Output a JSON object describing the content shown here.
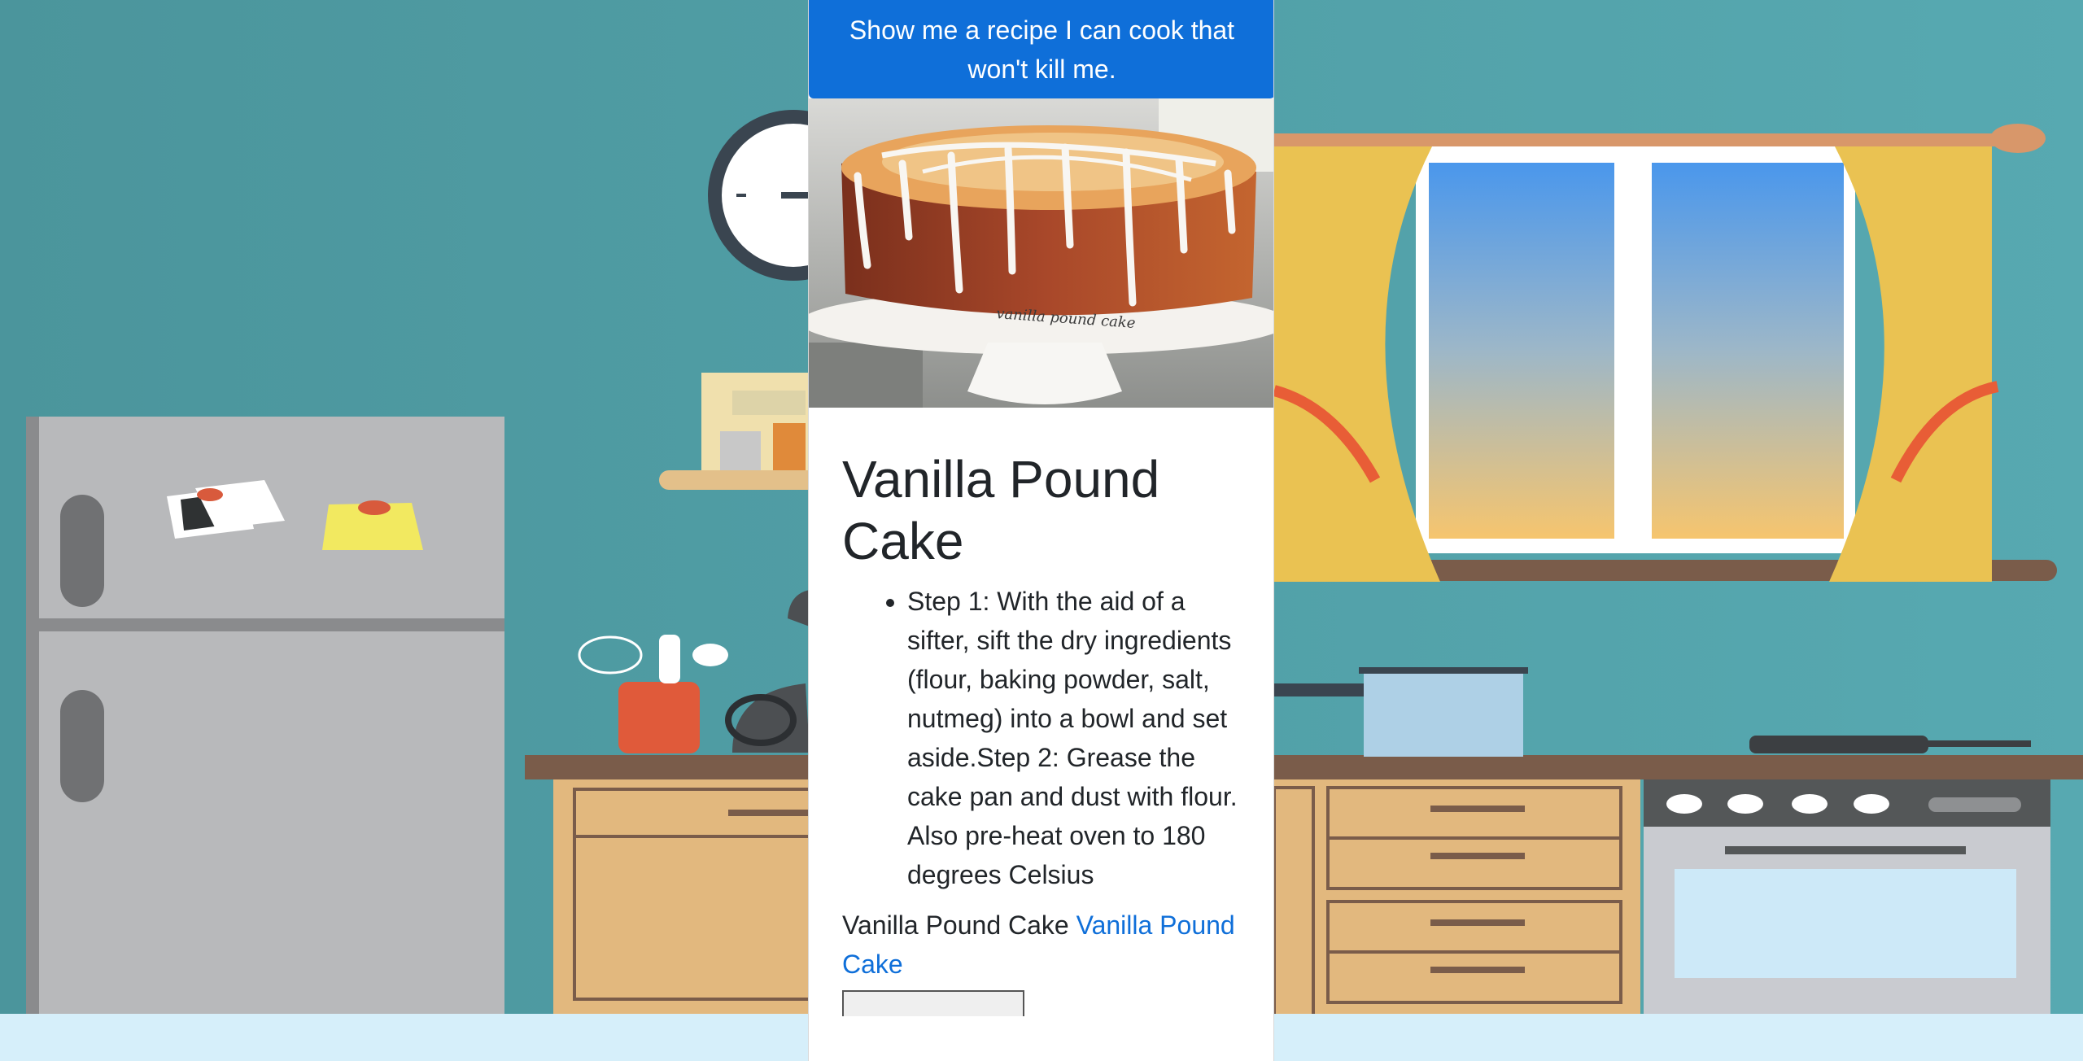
{
  "header_button": {
    "label": "Show me a recipe I can cook that won't kill me."
  },
  "recipe": {
    "title": "Vanilla Pound Cake",
    "image_caption": "vanilla pound cake",
    "steps": [
      "Step 1: With the aid of a sifter, sift the dry ingredients (flour, baking powder, salt, nutmeg) into a bowl and set aside.Step 2: Grease the cake pan and dust with flour. Also pre-heat oven to 180 degrees Celsius"
    ],
    "source_label": "Vanilla Pound Cake",
    "source_link": "Vanilla Pound Cake"
  },
  "colors": {
    "accent": "#0f6fd9",
    "wall": "#4f9aa1",
    "floor": "#d6effa"
  }
}
